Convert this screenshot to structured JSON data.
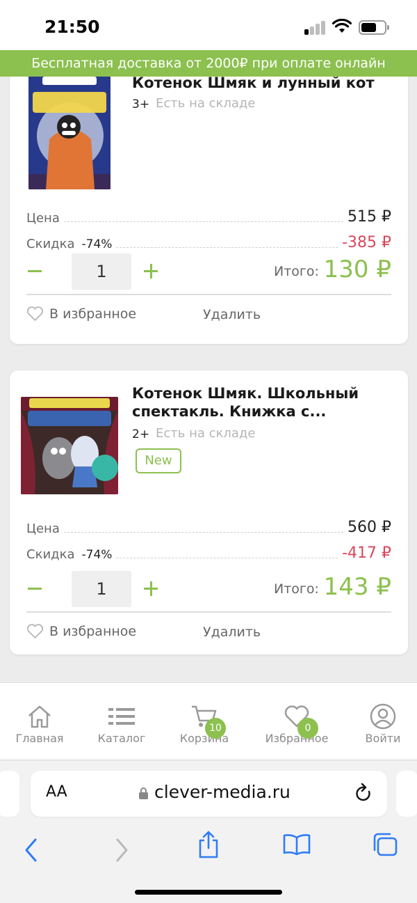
{
  "status_bar": {
    "time": "21:50"
  },
  "promo": {
    "text": "Бесплатная доставка от 2000₽ при оплате онлайн"
  },
  "cart": {
    "items": [
      {
        "title": "Котенок Шмяк и лунный кот",
        "age": "3+",
        "stock": "Есть на складе",
        "badge": "",
        "price_label": "Цена",
        "price": "515 ₽",
        "discount_label": "Скидка",
        "discount_pct": "-74%",
        "discount_value": "-385 ₽",
        "quantity": "1",
        "total_label": "Итого:",
        "total": "130 ₽",
        "fav_label": "В избранное",
        "remove_label": "Удалить"
      },
      {
        "title": "Котенок Шмяк. Школьный спектакль. Книжка с...",
        "age": "2+",
        "stock": "Есть на складе",
        "badge": "New",
        "price_label": "Цена",
        "price": "560 ₽",
        "discount_label": "Скидка",
        "discount_pct": "-74%",
        "discount_value": "-417 ₽",
        "quantity": "1",
        "total_label": "Итого:",
        "total": "143 ₽",
        "fav_label": "В избранное",
        "remove_label": "Удалить"
      }
    ]
  },
  "bottom_nav": {
    "items": [
      {
        "label": "Главная",
        "icon": "home-icon"
      },
      {
        "label": "Каталог",
        "icon": "list-icon"
      },
      {
        "label": "Корзина",
        "icon": "cart-icon",
        "badge": "10"
      },
      {
        "label": "Избранное",
        "icon": "heart-icon",
        "badge": "0"
      },
      {
        "label": "Войти",
        "icon": "user-icon"
      }
    ]
  },
  "browser": {
    "text_size_label": "AA",
    "url": "clever-media.ru"
  },
  "colors": {
    "accent": "#8cc04f",
    "discount": "#d9475d"
  }
}
